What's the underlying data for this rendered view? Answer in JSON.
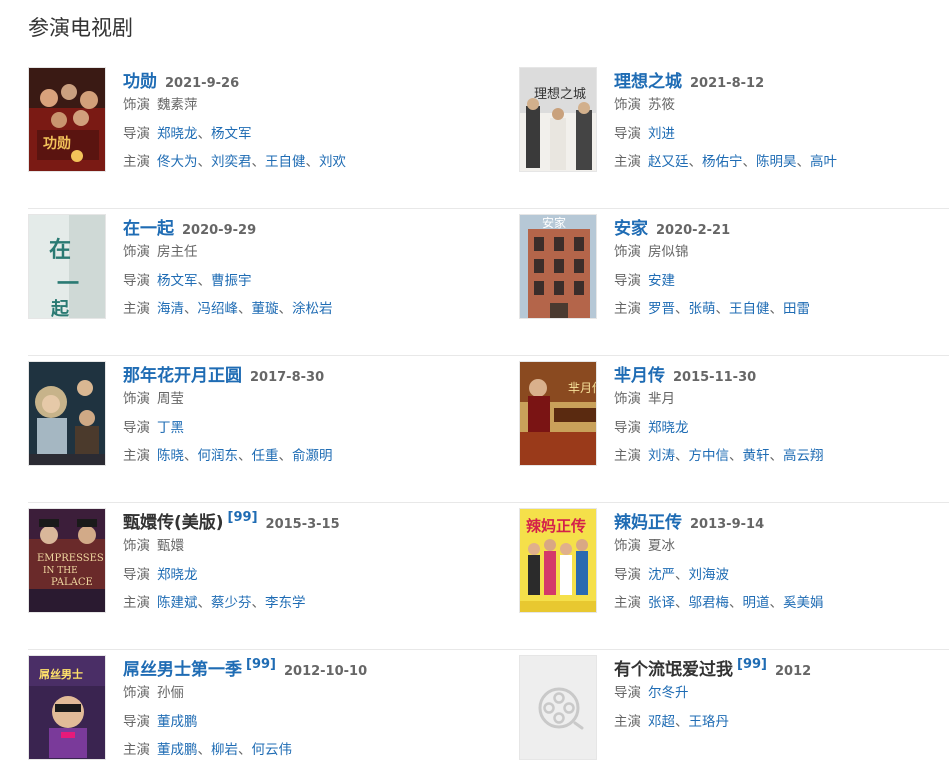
{
  "section_title": "参演电视剧",
  "labels": {
    "role": "饰演",
    "director": "导演",
    "cast": "主演",
    "sep": "、"
  },
  "items": [
    {
      "title": "功勋",
      "date": "2021-9-26",
      "role": "魏素萍",
      "directors": [
        "郑晓龙",
        "杨文军"
      ],
      "cast": [
        "佟大为",
        "刘奕君",
        "王自健",
        "刘欢"
      ],
      "poster": "poster-gongxun"
    },
    {
      "title": "理想之城",
      "date": "2021-8-12",
      "role": "苏筱",
      "directors": [
        "刘进"
      ],
      "cast": [
        "赵又廷",
        "杨佑宁",
        "陈明昊",
        "高叶"
      ],
      "poster": "poster-lixiangzhicheng"
    },
    {
      "title": "在一起",
      "date": "2020-9-29",
      "role": "房主任",
      "directors": [
        "杨文军",
        "曹振宇"
      ],
      "cast": [
        "海清",
        "冯绍峰",
        "董璇",
        "涂松岩"
      ],
      "poster": "poster-zaiyiqi"
    },
    {
      "title": "安家",
      "date": "2020-2-21",
      "role": "房似锦",
      "directors": [
        "安建"
      ],
      "cast": [
        "罗晋",
        "张萌",
        "王自健",
        "田雷"
      ],
      "poster": "poster-anjia"
    },
    {
      "title": "那年花开月正圆",
      "date": "2017-8-30",
      "role": "周莹",
      "directors": [
        "丁黑"
      ],
      "cast": [
        "陈晓",
        "何润东",
        "任重",
        "俞灏明"
      ],
      "poster": "poster-nanianhuakai"
    },
    {
      "title": "芈月传",
      "date": "2015-11-30",
      "role": "芈月",
      "directors": [
        "郑晓龙"
      ],
      "cast": [
        "刘涛",
        "方中信",
        "黄轩",
        "高云翔"
      ],
      "poster": "poster-miyuezhuan"
    },
    {
      "title": "甄嬛传(美版)",
      "badge": "[99]",
      "date": "2015-3-15",
      "role": "甄嬛",
      "directors": [
        "郑晓龙"
      ],
      "cast": [
        "陈建斌",
        "蔡少芬",
        "李东学"
      ],
      "poster": "poster-zhenhuanzhuan",
      "plain": true
    },
    {
      "title": "辣妈正传",
      "date": "2013-9-14",
      "role": "夏冰",
      "directors": [
        "沈严",
        "刘海波"
      ],
      "cast": [
        "张译",
        "邬君梅",
        "明道",
        "奚美娟"
      ],
      "poster": "poster-lamazhengzhuan"
    },
    {
      "title": "屌丝男士第一季",
      "badge": "[99]",
      "date": "2012-10-10",
      "role": "孙俪",
      "directors": [
        "董成鹏"
      ],
      "cast": [
        "董成鹏",
        "柳岩",
        "何云伟"
      ],
      "poster": "poster-diaosinanshi"
    },
    {
      "title": "有个流氓爱过我",
      "badge": "[99]",
      "date": "2012",
      "directors": [
        "尔冬升"
      ],
      "cast": [
        "邓超",
        "王珞丹"
      ],
      "poster": "film-reel-icon",
      "plain": true
    }
  ]
}
